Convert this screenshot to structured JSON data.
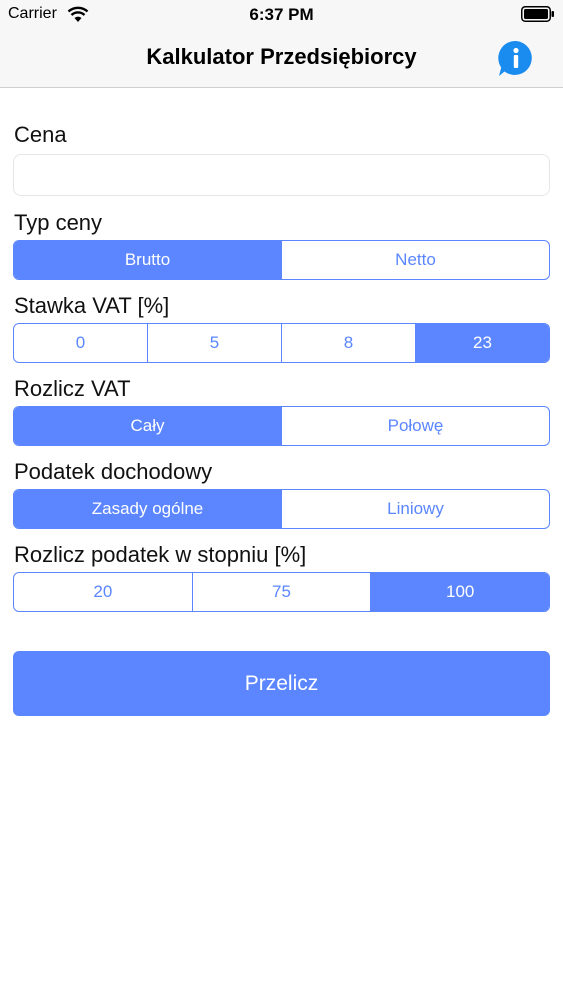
{
  "status_bar": {
    "carrier": "Carrier",
    "time": "6:37 PM"
  },
  "nav": {
    "title": "Kalkulator Przedsiębiorcy",
    "info_icon": "info-circle-icon",
    "accent": "#1a8cf0"
  },
  "form": {
    "price": {
      "label": "Cena",
      "value": "",
      "placeholder": ""
    },
    "price_type": {
      "label": "Typ ceny",
      "options": [
        "Brutto",
        "Netto"
      ],
      "selected": "Brutto"
    },
    "vat_rate": {
      "label": "Stawka VAT [%]",
      "options": [
        "0",
        "5",
        "8",
        "23"
      ],
      "selected": "23"
    },
    "vat_settle": {
      "label": "Rozlicz VAT",
      "options": [
        "Cały",
        "Połowę"
      ],
      "selected": "Cały"
    },
    "income_tax": {
      "label": "Podatek dochodowy",
      "options": [
        "Zasady ogólne",
        "Liniowy"
      ],
      "selected": "Zasady ogólne"
    },
    "tax_degree": {
      "label": "Rozlicz podatek w stopniu [%]",
      "options": [
        "20",
        "75",
        "100"
      ],
      "selected": "100"
    }
  },
  "actions": {
    "calculate": "Przelicz"
  },
  "colors": {
    "accent": "#5b86ff"
  }
}
